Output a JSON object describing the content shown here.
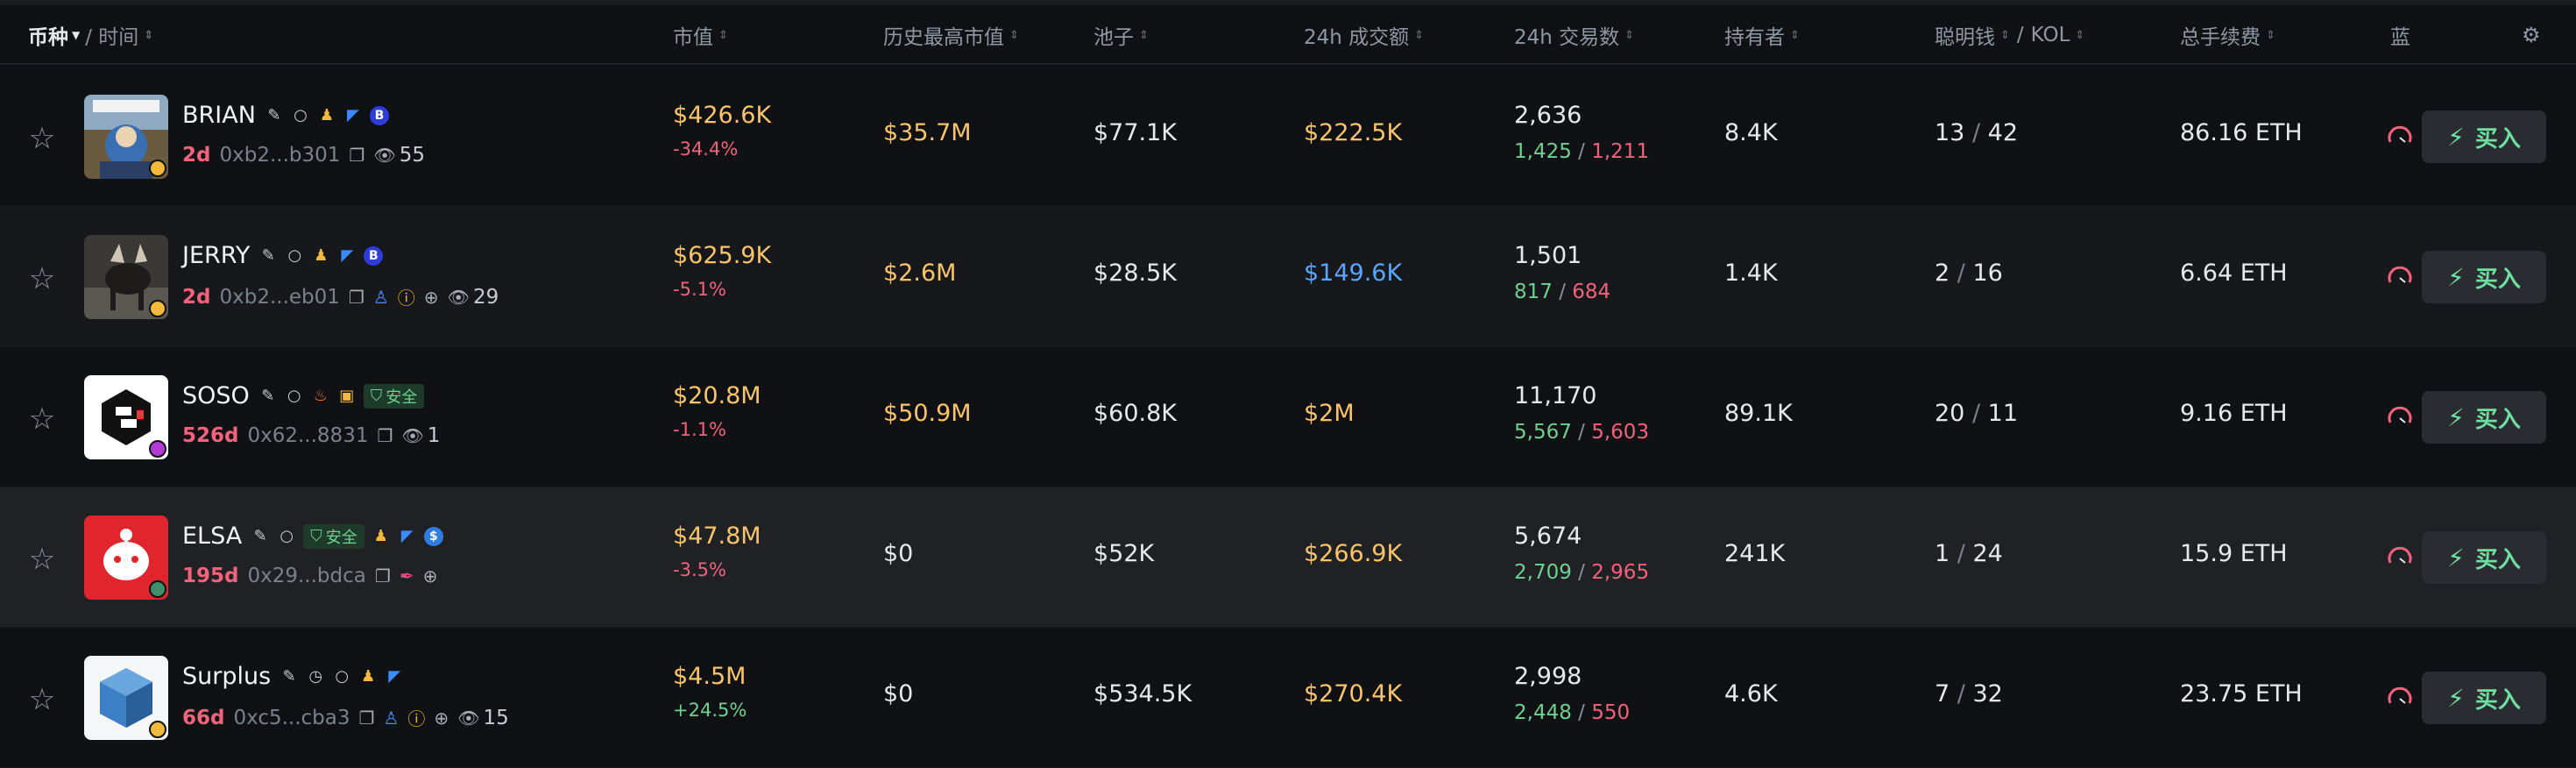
{
  "header": {
    "token_label": "币种",
    "time_label": "/ 时间",
    "columns": [
      "市值",
      "历史最高市值",
      "池子",
      "24h 成交额",
      "24h 交易数",
      "持有者",
      "聪明钱",
      "KOL",
      "总手续费",
      "蓝"
    ],
    "smart_sep": "/"
  },
  "buy_label": "买入",
  "colors": {
    "positive": "#6fd08f",
    "negative": "#f1637b",
    "gold": "#f9c46b",
    "blue_value": "#5aa5ff",
    "background": "#101114"
  },
  "rows": [
    {
      "name": "BRIAN",
      "age": "2d",
      "address": "0xb2...b301",
      "views": "55",
      "market_cap": "$426.6K",
      "change": "-34.4%",
      "change_dir": "neg",
      "ath": "$35.7M",
      "pool": "$77.1K",
      "volume": "$222.5K",
      "tx": "2,636",
      "buys": "1,425",
      "sells": "1,211",
      "holders": "8.4K",
      "smart": "13",
      "kol": "42",
      "fees": "86.16 ETH",
      "safe": "",
      "icons": [
        "edit-icon",
        "search-icon",
        "users-icon",
        "twitter-icon",
        "b-coin-icon"
      ]
    },
    {
      "name": "JERRY",
      "age": "2d",
      "address": "0xb2...eb01",
      "views": "29",
      "market_cap": "$625.9K",
      "change": "-5.1%",
      "change_dir": "neg",
      "ath": "$2.6M",
      "pool": "$28.5K",
      "volume": "$149.6K",
      "tx": "1,501",
      "buys": "817",
      "sells": "684",
      "holders": "1.4K",
      "smart": "2",
      "kol": "16",
      "fees": "6.64 ETH",
      "safe": "",
      "icons": [
        "edit-icon",
        "search-icon",
        "users-icon",
        "twitter-icon",
        "b-coin-icon"
      ]
    },
    {
      "name": "SOSO",
      "age": "526d",
      "address": "0x62...8831",
      "views": "1",
      "market_cap": "$20.8M",
      "change": "-1.1%",
      "change_dir": "neg",
      "ath": "$50.9M",
      "pool": "$60.8K",
      "volume": "$2M",
      "tx": "11,170",
      "buys": "5,567",
      "sells": "5,603",
      "holders": "89.1K",
      "smart": "20",
      "kol": "11",
      "fees": "9.16 ETH",
      "safe": "安全",
      "icons": [
        "edit-icon",
        "search-icon",
        "fire-icon",
        "gift-icon"
      ]
    },
    {
      "name": "ELSA",
      "age": "195d",
      "address": "0x29...bdca",
      "views": "",
      "market_cap": "$47.8M",
      "change": "-3.5%",
      "change_dir": "neg",
      "ath": "$0",
      "pool": "$52K",
      "volume": "$266.9K",
      "tx": "5,674",
      "buys": "2,709",
      "sells": "2,965",
      "holders": "241K",
      "smart": "1",
      "kol": "24",
      "fees": "15.9 ETH",
      "safe": "安全",
      "icons": [
        "edit-icon",
        "search-icon",
        "users-icon",
        "twitter-icon",
        "dollar-coin-icon"
      ]
    },
    {
      "name": "Surplus",
      "age": "66d",
      "address": "0xc5...cba3",
      "views": "15",
      "market_cap": "$4.5M",
      "change": "+24.5%",
      "change_dir": "pos",
      "ath": "$0",
      "pool": "$534.5K",
      "volume": "$270.4K",
      "tx": "2,998",
      "buys": "2,448",
      "sells": "550",
      "holders": "4.6K",
      "smart": "7",
      "kol": "32",
      "fees": "23.75 ETH",
      "safe": "",
      "icons": [
        "edit-icon",
        "clock-icon",
        "search-icon",
        "users-icon",
        "twitter-icon"
      ]
    }
  ]
}
